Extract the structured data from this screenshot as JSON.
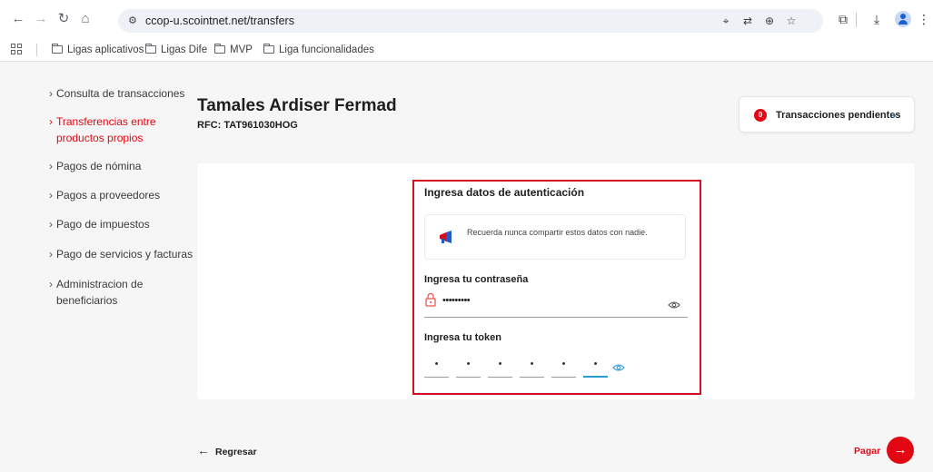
{
  "browser": {
    "url": "ccop-u.scointnet.net/transfers",
    "bookmarks": [
      {
        "label": "Ligas aplicativos"
      },
      {
        "label": "Ligas Dife"
      },
      {
        "label": "MVP"
      },
      {
        "label": "Liga funcionalidades"
      }
    ]
  },
  "sidebar": {
    "items": [
      {
        "label": "Consulta de transacciones",
        "active": false
      },
      {
        "label": "Transferencias entre productos propios",
        "active": true
      },
      {
        "label": "Pagos de nómina",
        "active": false
      },
      {
        "label": "Pagos a proveedores",
        "active": false
      },
      {
        "label": "Pago de impuestos",
        "active": false
      },
      {
        "label": "Pago de servicios y facturas",
        "active": false
      },
      {
        "label": "Administracion de beneficiarios",
        "active": false
      }
    ]
  },
  "client": {
    "name": "Tamales Ardiser Fermad",
    "rfc": "RFC: TAT961030HOG"
  },
  "pending": {
    "count": "0",
    "label": "Transacciones pendientes"
  },
  "auth": {
    "title": "Ingresa datos de autenticación",
    "notice": "Recuerda nunca compartir estos datos con nadie.",
    "password_label": "Ingresa tu contraseña",
    "password_value": "•••••••••",
    "token_label": "Ingresa tu token",
    "token_digits": [
      "•",
      "•",
      "•",
      "•",
      "•",
      "•"
    ]
  },
  "footer": {
    "back_label": "Regresar",
    "pay_label": "Pagar"
  },
  "colors": {
    "accent": "#e30613",
    "focus": "#2a9ad6",
    "link": "#1a73e8"
  }
}
